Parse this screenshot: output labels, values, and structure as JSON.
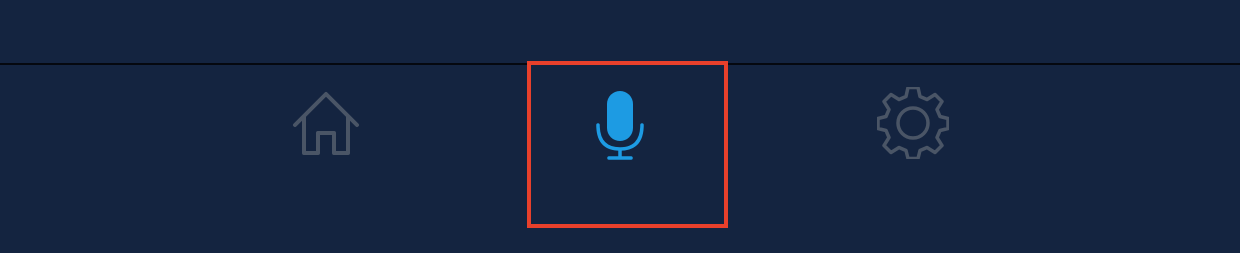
{
  "colors": {
    "background": "#142440",
    "divider": "#05080f",
    "inactive_icon": "#4a5566",
    "active_icon": "#1d9be3",
    "highlight": "#e8402b"
  },
  "tab_bar": {
    "tabs": [
      {
        "icon": "home-icon",
        "active": false
      },
      {
        "icon": "microphone-icon",
        "active": true
      },
      {
        "icon": "gear-icon",
        "active": false
      }
    ]
  }
}
